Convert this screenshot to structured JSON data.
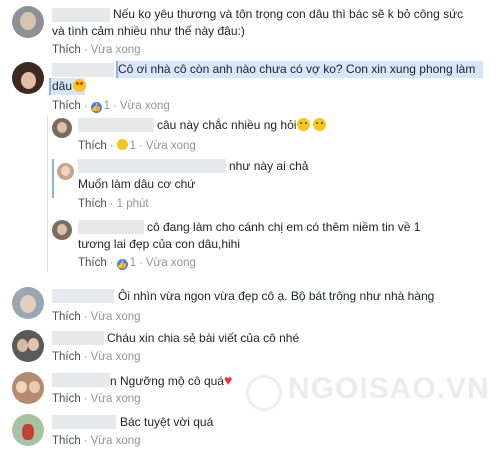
{
  "watermark": "NGOISAO.VN",
  "c1": {
    "text_line1": "Nếu ko yêu thương và tôn trọng con dâu thì bác sẽ k bỏ công sức",
    "text_line2": "và tình cảm nhiều như thế này đâu:)",
    "like": "Thích",
    "time": "Vừa xong"
  },
  "c2": {
    "text_line1": "Cô ơi nhà cô còn anh nào chưa có vợ ko? Con xin xung phong làm",
    "text_line2": "dâu",
    "like": "Thích",
    "reaction_count": "1",
    "time": "Vừa xong"
  },
  "r1": {
    "text": "câu này chắc nhiều ng hỏi",
    "like": "Thích",
    "reaction_count": "1",
    "time": "Vừa xong"
  },
  "r2": {
    "text_line1": "như này ai chả",
    "text_line2": "Muốn làm dâu cơ chứ",
    "like": "Thích",
    "time": "1 phút"
  },
  "r3": {
    "text_line1": "cô đang làm cho cánh chị em có thêm niềm tin về 1",
    "text_line2": "tương lai đẹp của con dâu,hihi",
    "like": "Thích",
    "reaction_count": "1",
    "time": "Vừa xong"
  },
  "c3": {
    "text": "Ôi nhìn vừa ngon vừa đẹp cô ạ. Bộ bát trông như nhà hàng",
    "like": "Thích",
    "time": "Vừa xong"
  },
  "c4": {
    "text": "Cháu xin chia sẻ bài viết của cô nhé",
    "like": "Thích",
    "time": "Vừa xong"
  },
  "c5": {
    "text": "n Ngưỡng mộ cô quá",
    "like": "Thích",
    "time": "Vừa xong"
  },
  "c6": {
    "text": "Bác tuyệt vời quá",
    "like": "Thích",
    "time": "Vừa xong"
  }
}
